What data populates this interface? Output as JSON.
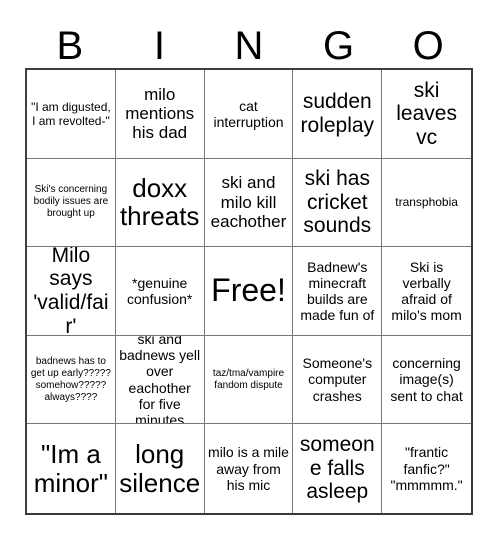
{
  "card": {
    "title": "BINGO",
    "header_letters": [
      "B",
      "I",
      "N",
      "G",
      "O"
    ],
    "rows": 5,
    "columns": 5,
    "free_space_label": "Free!",
    "free_space_position": "center",
    "colors": {
      "background": "#ffffff",
      "text": "#000000",
      "grid_line": "#777777",
      "grid_outer_border": "#3a3a3a"
    },
    "cells": [
      {
        "id": "b1",
        "column": "B",
        "row": 1,
        "text": "\"I am digusted, I am revolted-\"",
        "size": "sm",
        "marked": false
      },
      {
        "id": "i1",
        "column": "I",
        "row": 1,
        "text": "milo mentions his dad",
        "size": "lg",
        "marked": false
      },
      {
        "id": "n1",
        "column": "N",
        "row": 1,
        "text": "cat interruption",
        "size": "md",
        "marked": false
      },
      {
        "id": "g1",
        "column": "G",
        "row": 1,
        "text": "sudden roleplay",
        "size": "xl",
        "marked": false
      },
      {
        "id": "o1",
        "column": "O",
        "row": 1,
        "text": "ski leaves vc",
        "size": "xl",
        "marked": false
      },
      {
        "id": "b2",
        "column": "B",
        "row": 2,
        "text": "Ski's concerning bodily issues are brought up",
        "size": "xs",
        "marked": false
      },
      {
        "id": "i2",
        "column": "I",
        "row": 2,
        "text": "doxx threats",
        "size": "xxl",
        "marked": false
      },
      {
        "id": "n2",
        "column": "N",
        "row": 2,
        "text": "ski and milo kill eachother",
        "size": "lg",
        "marked": false
      },
      {
        "id": "g2",
        "column": "G",
        "row": 2,
        "text": "ski has cricket sounds",
        "size": "xl",
        "marked": false
      },
      {
        "id": "o2",
        "column": "O",
        "row": 2,
        "text": "transphobia",
        "size": "sm",
        "marked": false
      },
      {
        "id": "b3",
        "column": "B",
        "row": 3,
        "text": "Milo says 'valid/fair'",
        "size": "xl",
        "marked": false
      },
      {
        "id": "i3",
        "column": "I",
        "row": 3,
        "text": "*genuine confusion*",
        "size": "md",
        "marked": false
      },
      {
        "id": "n3",
        "column": "N",
        "row": 3,
        "text": "Free!",
        "size": "free",
        "marked": false
      },
      {
        "id": "g3",
        "column": "G",
        "row": 3,
        "text": "Badnew's minecraft builds are made fun of",
        "size": "md",
        "marked": false
      },
      {
        "id": "o3",
        "column": "O",
        "row": 3,
        "text": "Ski is verbally afraid of milo's mom",
        "size": "md",
        "marked": false
      },
      {
        "id": "b4",
        "column": "B",
        "row": 4,
        "text": "badnews has to get up early????? somehow????? always????",
        "size": "xs",
        "marked": false
      },
      {
        "id": "i4",
        "column": "I",
        "row": 4,
        "text": "ski and badnews yell over eachother for five minutes",
        "size": "md",
        "marked": false
      },
      {
        "id": "n4",
        "column": "N",
        "row": 4,
        "text": "taz/tma/vampire fandom dispute",
        "size": "xs",
        "marked": false
      },
      {
        "id": "g4",
        "column": "G",
        "row": 4,
        "text": "Someone's computer crashes",
        "size": "md",
        "marked": false
      },
      {
        "id": "o4",
        "column": "O",
        "row": 4,
        "text": "concerning image(s) sent to chat",
        "size": "md",
        "marked": false
      },
      {
        "id": "b5",
        "column": "B",
        "row": 5,
        "text": "\"Im a minor\"",
        "size": "xxl",
        "marked": false
      },
      {
        "id": "i5",
        "column": "I",
        "row": 5,
        "text": "long silence",
        "size": "xxl",
        "marked": false
      },
      {
        "id": "n5",
        "column": "N",
        "row": 5,
        "text": "milo is a mile away from his mic",
        "size": "md",
        "marked": false
      },
      {
        "id": "g5",
        "column": "G",
        "row": 5,
        "text": "someone falls asleep",
        "size": "xl",
        "marked": false
      },
      {
        "id": "o5",
        "column": "O",
        "row": 5,
        "text": "\"frantic fanfic?\" \"mmmmm.\"",
        "size": "md",
        "marked": false
      }
    ]
  }
}
